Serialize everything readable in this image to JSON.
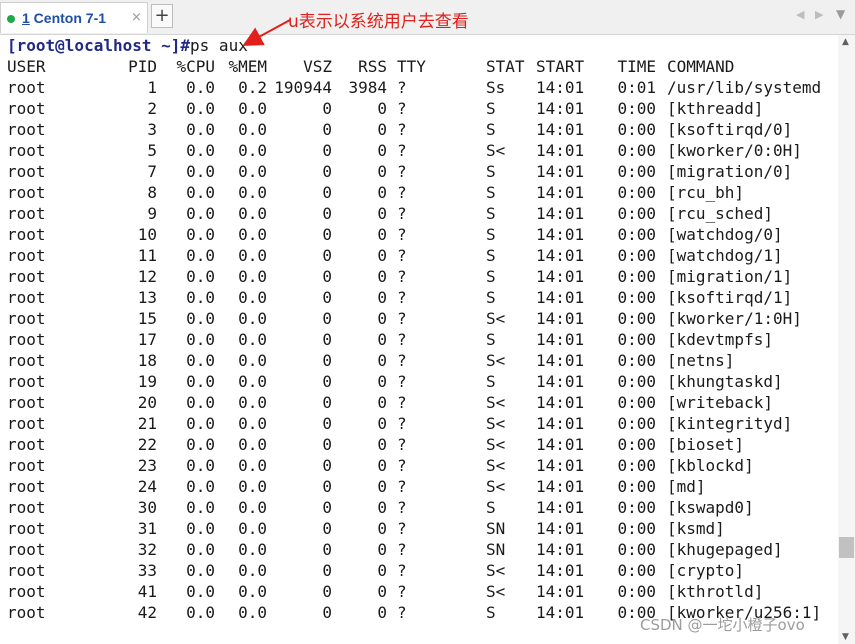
{
  "tab": {
    "number": "1",
    "title": " Centon 7-1",
    "close_icon": "×"
  },
  "add_tab_label": "+",
  "nav": {
    "prev": "◀",
    "next": "▶",
    "menu": "▼"
  },
  "prompt": "[root@localhost ~]#",
  "command": "ps aux",
  "columns": [
    "USER",
    "PID",
    "%CPU",
    "%MEM",
    "VSZ",
    "RSS",
    "TTY",
    "STAT",
    "START",
    "TIME",
    "COMMAND"
  ],
  "rows": [
    [
      "root",
      "1",
      "0.0",
      "0.2",
      "190944",
      "3984",
      "?",
      "Ss",
      "14:01",
      "0:01",
      "/usr/lib/systemd"
    ],
    [
      "root",
      "2",
      "0.0",
      "0.0",
      "0",
      "0",
      "?",
      "S",
      "14:01",
      "0:00",
      "[kthreadd]"
    ],
    [
      "root",
      "3",
      "0.0",
      "0.0",
      "0",
      "0",
      "?",
      "S",
      "14:01",
      "0:00",
      "[ksoftirqd/0]"
    ],
    [
      "root",
      "5",
      "0.0",
      "0.0",
      "0",
      "0",
      "?",
      "S<",
      "14:01",
      "0:00",
      "[kworker/0:0H]"
    ],
    [
      "root",
      "7",
      "0.0",
      "0.0",
      "0",
      "0",
      "?",
      "S",
      "14:01",
      "0:00",
      "[migration/0]"
    ],
    [
      "root",
      "8",
      "0.0",
      "0.0",
      "0",
      "0",
      "?",
      "S",
      "14:01",
      "0:00",
      "[rcu_bh]"
    ],
    [
      "root",
      "9",
      "0.0",
      "0.0",
      "0",
      "0",
      "?",
      "S",
      "14:01",
      "0:00",
      "[rcu_sched]"
    ],
    [
      "root",
      "10",
      "0.0",
      "0.0",
      "0",
      "0",
      "?",
      "S",
      "14:01",
      "0:00",
      "[watchdog/0]"
    ],
    [
      "root",
      "11",
      "0.0",
      "0.0",
      "0",
      "0",
      "?",
      "S",
      "14:01",
      "0:00",
      "[watchdog/1]"
    ],
    [
      "root",
      "12",
      "0.0",
      "0.0",
      "0",
      "0",
      "?",
      "S",
      "14:01",
      "0:00",
      "[migration/1]"
    ],
    [
      "root",
      "13",
      "0.0",
      "0.0",
      "0",
      "0",
      "?",
      "S",
      "14:01",
      "0:00",
      "[ksoftirqd/1]"
    ],
    [
      "root",
      "15",
      "0.0",
      "0.0",
      "0",
      "0",
      "?",
      "S<",
      "14:01",
      "0:00",
      "[kworker/1:0H]"
    ],
    [
      "root",
      "17",
      "0.0",
      "0.0",
      "0",
      "0",
      "?",
      "S",
      "14:01",
      "0:00",
      "[kdevtmpfs]"
    ],
    [
      "root",
      "18",
      "0.0",
      "0.0",
      "0",
      "0",
      "?",
      "S<",
      "14:01",
      "0:00",
      "[netns]"
    ],
    [
      "root",
      "19",
      "0.0",
      "0.0",
      "0",
      "0",
      "?",
      "S",
      "14:01",
      "0:00",
      "[khungtaskd]"
    ],
    [
      "root",
      "20",
      "0.0",
      "0.0",
      "0",
      "0",
      "?",
      "S<",
      "14:01",
      "0:00",
      "[writeback]"
    ],
    [
      "root",
      "21",
      "0.0",
      "0.0",
      "0",
      "0",
      "?",
      "S<",
      "14:01",
      "0:00",
      "[kintegrityd]"
    ],
    [
      "root",
      "22",
      "0.0",
      "0.0",
      "0",
      "0",
      "?",
      "S<",
      "14:01",
      "0:00",
      "[bioset]"
    ],
    [
      "root",
      "23",
      "0.0",
      "0.0",
      "0",
      "0",
      "?",
      "S<",
      "14:01",
      "0:00",
      "[kblockd]"
    ],
    [
      "root",
      "24",
      "0.0",
      "0.0",
      "0",
      "0",
      "?",
      "S<",
      "14:01",
      "0:00",
      "[md]"
    ],
    [
      "root",
      "30",
      "0.0",
      "0.0",
      "0",
      "0",
      "?",
      "S",
      "14:01",
      "0:00",
      "[kswapd0]"
    ],
    [
      "root",
      "31",
      "0.0",
      "0.0",
      "0",
      "0",
      "?",
      "SN",
      "14:01",
      "0:00",
      "[ksmd]"
    ],
    [
      "root",
      "32",
      "0.0",
      "0.0",
      "0",
      "0",
      "?",
      "SN",
      "14:01",
      "0:00",
      "[khugepaged]"
    ],
    [
      "root",
      "33",
      "0.0",
      "0.0",
      "0",
      "0",
      "?",
      "S<",
      "14:01",
      "0:00",
      "[crypto]"
    ],
    [
      "root",
      "41",
      "0.0",
      "0.0",
      "0",
      "0",
      "?",
      "S<",
      "14:01",
      "0:00",
      "[kthrotld]"
    ],
    [
      "root",
      "42",
      "0.0",
      "0.0",
      "0",
      "0",
      "?",
      "S",
      "14:01",
      "0:00",
      "[kworker/u256:1]"
    ]
  ],
  "annotation": "u表示以系统用户去查看",
  "watermark": "CSDN @一坨小橙子ovo",
  "colors": {
    "prompt": "#1f2a87",
    "annotation": "#e0201b",
    "tab_title": "#1e4fa3",
    "tab_dot": "#22a84a"
  }
}
